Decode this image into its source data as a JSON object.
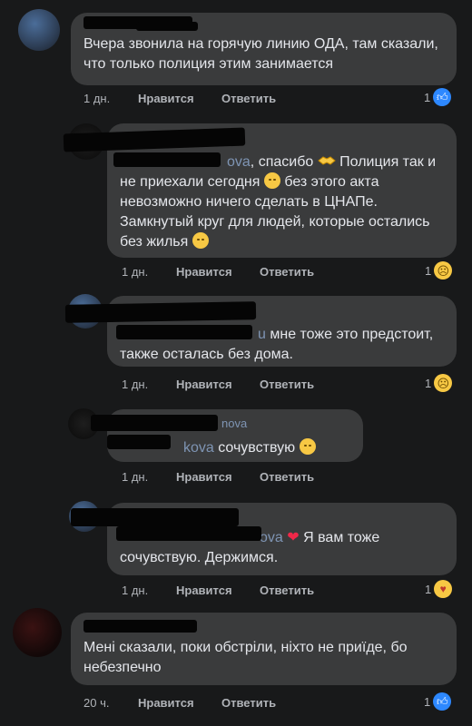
{
  "comments": [
    {
      "text": "Вчера звонила на горячую линию ОДА, там сказали, что только полиция этим занимается",
      "time": "1 дн.",
      "like": "Нравится",
      "reply": "Ответить",
      "reaction_count": "1",
      "reaction_icon": "like-icon"
    },
    {
      "text_a": ", спасибо",
      "text_b": " Полиция так и не приехали сегодня",
      "text_c": " без этого акта невозможно ничего сделать в ЦНАПе. Замкнутый круг для людей, которые остались без жилья",
      "name_fragment": "ova",
      "time": "1 дн.",
      "like": "Нравится",
      "reply": "Ответить",
      "reaction_count": "1",
      "reaction_icon": "sad-icon"
    },
    {
      "text": " мне тоже это предстоит, также осталась без дома.",
      "name_fragment": "u",
      "time": "1 дн.",
      "like": "Нравится",
      "reply": "Ответить",
      "reaction_count": "1",
      "reaction_icon": "sad-icon"
    },
    {
      "text": " сочувствую",
      "name_fragment": "kova",
      "name_fragment_top": "nova",
      "time": "1 дн.",
      "like": "Нравится",
      "reply": "Ответить"
    },
    {
      "text_a": " Я вам тоже",
      "text_b": "сочувствую. Держимся.",
      "name_fragment": "ova",
      "time": "1 дн.",
      "like": "Нравится",
      "reply": "Ответить",
      "reaction_count": "1",
      "reaction_icon": "care-icon"
    },
    {
      "text": "Мені сказали, поки обстріли, ніхто не приїде, бо небезпечно",
      "time": "20 ч.",
      "like": "Нравится",
      "reply": "Ответить",
      "reaction_count": "1",
      "reaction_icon": "like-icon"
    }
  ],
  "colors": {
    "background": "#18191a",
    "bubble": "#3a3b3c",
    "text": "#e4e6eb",
    "meta": "#b0b3b8",
    "like_blue": "#2d88ff"
  }
}
